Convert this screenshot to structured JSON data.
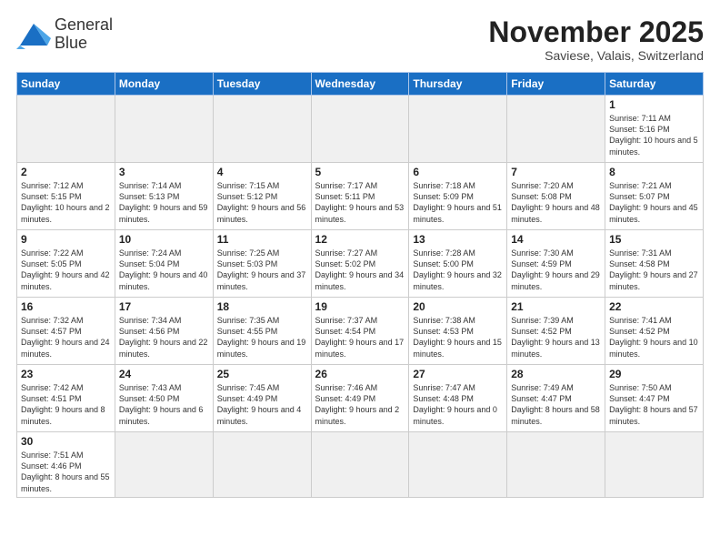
{
  "header": {
    "logo_line1": "General",
    "logo_line2": "Blue",
    "month_title": "November 2025",
    "subtitle": "Saviese, Valais, Switzerland"
  },
  "weekdays": [
    "Sunday",
    "Monday",
    "Tuesday",
    "Wednesday",
    "Thursday",
    "Friday",
    "Saturday"
  ],
  "weeks": [
    [
      {
        "num": "",
        "info": "",
        "empty": true
      },
      {
        "num": "",
        "info": "",
        "empty": true
      },
      {
        "num": "",
        "info": "",
        "empty": true
      },
      {
        "num": "",
        "info": "",
        "empty": true
      },
      {
        "num": "",
        "info": "",
        "empty": true
      },
      {
        "num": "",
        "info": "",
        "empty": true
      },
      {
        "num": "1",
        "info": "Sunrise: 7:11 AM\nSunset: 5:16 PM\nDaylight: 10 hours and 5 minutes."
      }
    ],
    [
      {
        "num": "2",
        "info": "Sunrise: 7:12 AM\nSunset: 5:15 PM\nDaylight: 10 hours and 2 minutes."
      },
      {
        "num": "3",
        "info": "Sunrise: 7:14 AM\nSunset: 5:13 PM\nDaylight: 9 hours and 59 minutes."
      },
      {
        "num": "4",
        "info": "Sunrise: 7:15 AM\nSunset: 5:12 PM\nDaylight: 9 hours and 56 minutes."
      },
      {
        "num": "5",
        "info": "Sunrise: 7:17 AM\nSunset: 5:11 PM\nDaylight: 9 hours and 53 minutes."
      },
      {
        "num": "6",
        "info": "Sunrise: 7:18 AM\nSunset: 5:09 PM\nDaylight: 9 hours and 51 minutes."
      },
      {
        "num": "7",
        "info": "Sunrise: 7:20 AM\nSunset: 5:08 PM\nDaylight: 9 hours and 48 minutes."
      },
      {
        "num": "8",
        "info": "Sunrise: 7:21 AM\nSunset: 5:07 PM\nDaylight: 9 hours and 45 minutes."
      }
    ],
    [
      {
        "num": "9",
        "info": "Sunrise: 7:22 AM\nSunset: 5:05 PM\nDaylight: 9 hours and 42 minutes."
      },
      {
        "num": "10",
        "info": "Sunrise: 7:24 AM\nSunset: 5:04 PM\nDaylight: 9 hours and 40 minutes."
      },
      {
        "num": "11",
        "info": "Sunrise: 7:25 AM\nSunset: 5:03 PM\nDaylight: 9 hours and 37 minutes."
      },
      {
        "num": "12",
        "info": "Sunrise: 7:27 AM\nSunset: 5:02 PM\nDaylight: 9 hours and 34 minutes."
      },
      {
        "num": "13",
        "info": "Sunrise: 7:28 AM\nSunset: 5:00 PM\nDaylight: 9 hours and 32 minutes."
      },
      {
        "num": "14",
        "info": "Sunrise: 7:30 AM\nSunset: 4:59 PM\nDaylight: 9 hours and 29 minutes."
      },
      {
        "num": "15",
        "info": "Sunrise: 7:31 AM\nSunset: 4:58 PM\nDaylight: 9 hours and 27 minutes."
      }
    ],
    [
      {
        "num": "16",
        "info": "Sunrise: 7:32 AM\nSunset: 4:57 PM\nDaylight: 9 hours and 24 minutes."
      },
      {
        "num": "17",
        "info": "Sunrise: 7:34 AM\nSunset: 4:56 PM\nDaylight: 9 hours and 22 minutes."
      },
      {
        "num": "18",
        "info": "Sunrise: 7:35 AM\nSunset: 4:55 PM\nDaylight: 9 hours and 19 minutes."
      },
      {
        "num": "19",
        "info": "Sunrise: 7:37 AM\nSunset: 4:54 PM\nDaylight: 9 hours and 17 minutes."
      },
      {
        "num": "20",
        "info": "Sunrise: 7:38 AM\nSunset: 4:53 PM\nDaylight: 9 hours and 15 minutes."
      },
      {
        "num": "21",
        "info": "Sunrise: 7:39 AM\nSunset: 4:52 PM\nDaylight: 9 hours and 13 minutes."
      },
      {
        "num": "22",
        "info": "Sunrise: 7:41 AM\nSunset: 4:52 PM\nDaylight: 9 hours and 10 minutes."
      }
    ],
    [
      {
        "num": "23",
        "info": "Sunrise: 7:42 AM\nSunset: 4:51 PM\nDaylight: 9 hours and 8 minutes."
      },
      {
        "num": "24",
        "info": "Sunrise: 7:43 AM\nSunset: 4:50 PM\nDaylight: 9 hours and 6 minutes."
      },
      {
        "num": "25",
        "info": "Sunrise: 7:45 AM\nSunset: 4:49 PM\nDaylight: 9 hours and 4 minutes."
      },
      {
        "num": "26",
        "info": "Sunrise: 7:46 AM\nSunset: 4:49 PM\nDaylight: 9 hours and 2 minutes."
      },
      {
        "num": "27",
        "info": "Sunrise: 7:47 AM\nSunset: 4:48 PM\nDaylight: 9 hours and 0 minutes."
      },
      {
        "num": "28",
        "info": "Sunrise: 7:49 AM\nSunset: 4:47 PM\nDaylight: 8 hours and 58 minutes."
      },
      {
        "num": "29",
        "info": "Sunrise: 7:50 AM\nSunset: 4:47 PM\nDaylight: 8 hours and 57 minutes."
      }
    ],
    [
      {
        "num": "30",
        "info": "Sunrise: 7:51 AM\nSunset: 4:46 PM\nDaylight: 8 hours and 55 minutes.",
        "last": true
      },
      {
        "num": "",
        "info": "",
        "empty": true,
        "last": true
      },
      {
        "num": "",
        "info": "",
        "empty": true,
        "last": true
      },
      {
        "num": "",
        "info": "",
        "empty": true,
        "last": true
      },
      {
        "num": "",
        "info": "",
        "empty": true,
        "last": true
      },
      {
        "num": "",
        "info": "",
        "empty": true,
        "last": true
      },
      {
        "num": "",
        "info": "",
        "empty": true,
        "last": true
      }
    ]
  ]
}
